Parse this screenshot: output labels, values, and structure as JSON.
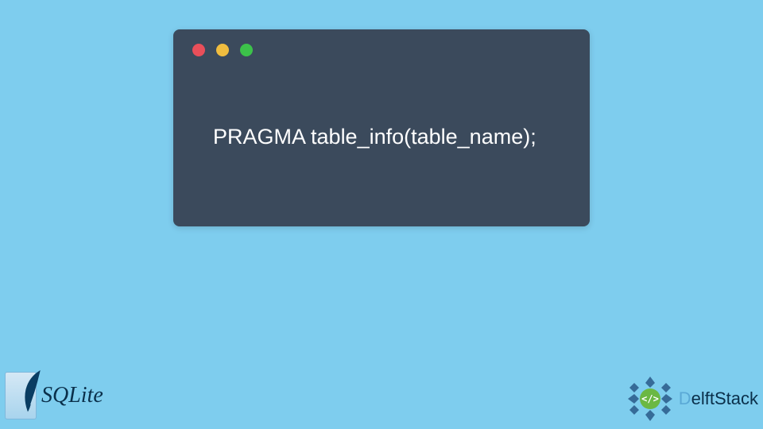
{
  "code_window": {
    "code": "PRAGMA table_info(table_name);"
  },
  "sqlite_logo": {
    "text": "SQLite"
  },
  "delft_logo": {
    "text_prefix": "D",
    "text_rest": "elftStack"
  }
}
